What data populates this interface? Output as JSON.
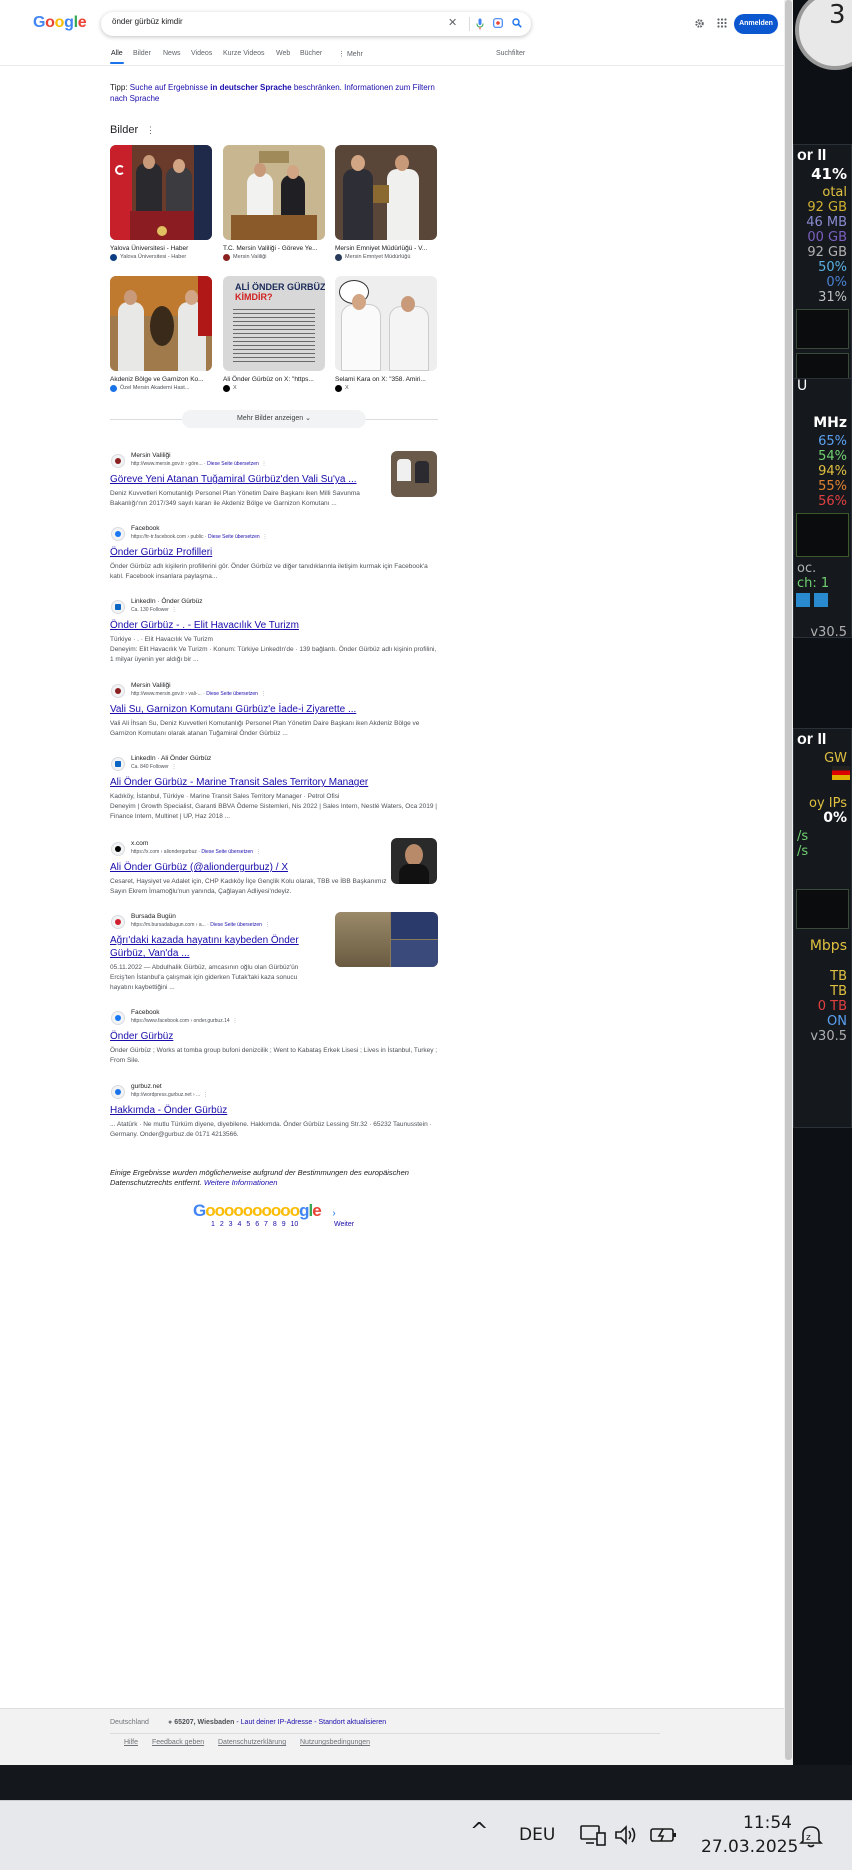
{
  "search": {
    "logo": [
      "G",
      "o",
      "o",
      "g",
      "l",
      "e"
    ],
    "query": "önder gürbüz kimdir",
    "signin_label": "Anmelden"
  },
  "tabs": [
    "Alle",
    "Bilder",
    "News",
    "Videos",
    "Kurze Videos",
    "Web",
    "Bücher",
    "⋮ Mehr"
  ],
  "tools_label": "Suchfilter",
  "tip": {
    "prefix": "Tipp:",
    "link1": "Suche auf Ergebnisse",
    "bold": "in deutscher Sprache",
    "link2": "beschränken.",
    "link3": "Informationen zum Filtern nach Sprache"
  },
  "images_section": {
    "title": "Bilder",
    "items": [
      {
        "caption": "Yalova Üniversitesi - Haber",
        "source": "Yalova Üniversitesi - Haber"
      },
      {
        "caption": "T.C. Mersin Valiliği - Göreve Ye...",
        "source": "Mersin Valiliği"
      },
      {
        "caption": "Mersin Emniyet Müdürlüğü - V...",
        "source": "Mersin Emniyet Müdürlüğü"
      },
      {
        "caption": "Akdeniz Bölge ve Garnizon Ko...",
        "source": "Özel Mersin Akademi Hast..."
      },
      {
        "caption": "Ali Önder Gürbüz on X: \"https...",
        "source": "X"
      },
      {
        "caption": "Selami Kara on X: \"358. Amiri...",
        "source": "X"
      }
    ],
    "card4_text": {
      "headline1": "ALİ ÖNDER GÜRBÜZ",
      "headline2": "KİMDİR?"
    },
    "more_label": "Mehr Bilder anzeigen"
  },
  "results": [
    {
      "site": "Mersin Valiliği",
      "url": "http://www.mersin.gov.tr › göre...",
      "translate": "Diese Seite übersetzen",
      "title": "Göreve Yeni Atanan Tuğamiral Gürbüz'den Vali Su'ya ...",
      "snippet": "Deniz Kuvvetleri Komutanlığı Personel Plan Yönetim Daire Başkanı iken Milli Savunma Bakanlığı'nın 2017/349 sayılı kararı ile Akdeniz Bölge ve Garnizon Komutanı ..."
    },
    {
      "site": "Facebook",
      "url": "https://tr-tr.facebook.com › public",
      "translate": "Diese Seite übersetzen",
      "title": "Önder Gürbüz Profilleri",
      "snippet": "Önder Gürbüz adlı kişilerin profillerini gör. Önder Gürbüz ve diğer tanıdıklarınla iletişim kurmak için Facebook'a katıl. Facebook insanlara paylaşma..."
    },
    {
      "site": "LinkedIn · Önder Gürbüz",
      "url": "Ca. 130 Follower",
      "title": "Önder Gürbüz - . - Elit Havacılık Ve Turizm",
      "snippet_line1": "Türkiye · . · Elit Havacılık Ve Turizm",
      "snippet": "Deneyim: Elit Havacılık Ve Turizm · Konum: Türkiye LinkedIn'de · 139 bağlantı. Önder Gürbüz adlı kişinin profilini, 1 milyar üyenin yer aldığı bir ..."
    },
    {
      "site": "Mersin Valiliği",
      "url": "http://www.mersin.gov.tr › vali-...",
      "translate": "Diese Seite übersetzen",
      "title": "Vali Su, Garnizon Komutanı Gürbüz'e İade-i Ziyarette ...",
      "snippet": "Vali Ali İhsan Su, Deniz Kuvvetleri Komutanlığı Personel Plan Yönetim Daire Başkanı iken Akdeniz Bölge ve Garnizon Komutanı olarak atanan Tuğamiral Önder Gürbüz ..."
    },
    {
      "site": "LinkedIn · Ali Önder Gürbüz",
      "url": "Ca. 840 Follower",
      "title": "Ali Önder Gürbüz - Marine Transit Sales Territory Manager",
      "snippet_line1": "Kadıköy, İstanbul, Türkiye · Marine Transit Sales Territory Manager · Petrol Ofisi",
      "snippet": "Deneyim | Growth Specialist, Garanti BBVA Ödeme Sistemleri, Nis 2022 | Sales Intern, Nestlé Waters, Oca 2019 | Finance Intern, Multinet | UP, Haz 2018 ..."
    },
    {
      "site": "x.com",
      "url": "https://x.com › aliondergurbuz",
      "translate": "Diese Seite übersetzen",
      "title": "Ali Önder Gürbüz (@aliondergurbuz) / X",
      "snippet": "Cesaret, Haysiyet ve Adalet için, CHP Kadıköy İlçe Gençlik Kolu olarak, TBB ve İBB Başkanımız Sayın Ekrem İmamoğlu'nun yanında, Çağlayan Adliyesi'ndeyiz."
    },
    {
      "site": "Bursada Bugün",
      "url": "https://m.bursadabugun.com › a...",
      "translate": "Diese Seite übersetzen",
      "title": "Ağrı'daki kazada hayatını kaybeden Önder",
      "title2": "Gürbüz, Van'da ...",
      "snippet": "05.11.2022 — Abdulhalik Gürbüz, amcasının oğlu olan Gürbüz'ün Erciş'ten İstanbul'a çalışmak için giderken Tutak'taki kaza sonucu hayatını kaybettiğini ..."
    },
    {
      "site": "Facebook",
      "url": "https://www.facebook.com › onder.gurbuz.14",
      "title": "Önder Gürbüz",
      "snippet": "Önder Gürbüz ; Works at tomba group bufoni denizcilik ; Went to Kabataş Erkek Lisesi ; Lives in İstanbul, Turkey ; From Sile."
    },
    {
      "site": "gurbuz.net",
      "url": "http://wordpress.gurbuz.net › ...",
      "title": "Hakkımda - Önder Gürbüz",
      "snippet": "... Atatürk · Ne mutlu Türküm diyene, diyebilene. Hakkımda. Önder Gürbüz Lessing Str.32 · 65232 Taunusstein · Germany. Onder@gurbuz.de 0171 4213566."
    }
  ],
  "privacy_note": "Einige Ergebnisse wurden möglicherweise aufgrund der Bestimmungen des europäischen Datenschutzrechts entfernt.",
  "privacy_link": "Weitere Informationen",
  "pagination": {
    "logo": "Gooooooooooogle",
    "pages": "1 2 3 4 5 6 7 8 9 10",
    "next_label": "Weiter"
  },
  "footer": {
    "country": "Deutschland",
    "location": "65207, Wiesbaden",
    "location_suffix": "- Laut deiner IP-Adresse - Standort aktualisieren",
    "links": [
      "Hilfe",
      "Feedback geben",
      "Datenschutzerklärung",
      "Nutzungsbedingungen"
    ]
  },
  "widgets": {
    "cpu_title": "or II",
    "cpu_rows": [
      "41%",
      "otal",
      "92 GB",
      "46 MB",
      "00 GB",
      "92 GB",
      "50%",
      "0%",
      "31%"
    ],
    "gpu_rows": [
      "U",
      "MHz",
      "65%",
      "54%",
      "94%",
      "55%",
      "56%"
    ],
    "net_rows": [
      "oc.",
      "ch: 1",
      "v30.5"
    ],
    "net_title": "or II",
    "net_rows2": [
      "GW",
      "oy IPs",
      "0%",
      "/s",
      "/s"
    ],
    "disk_rows": [
      "Mbps",
      "TB",
      "TB",
      "0 TB",
      "ON",
      "v30.5"
    ]
  },
  "taskbar": {
    "language": "DEU",
    "time": "11:54",
    "date": "27.03.2025"
  },
  "colors": {
    "google_blue": "#4285f4",
    "google_red": "#ea4335",
    "google_yellow": "#fbbc05",
    "google_green": "#34a853",
    "link": "#1a0dab",
    "signin": "#0b57d0"
  }
}
